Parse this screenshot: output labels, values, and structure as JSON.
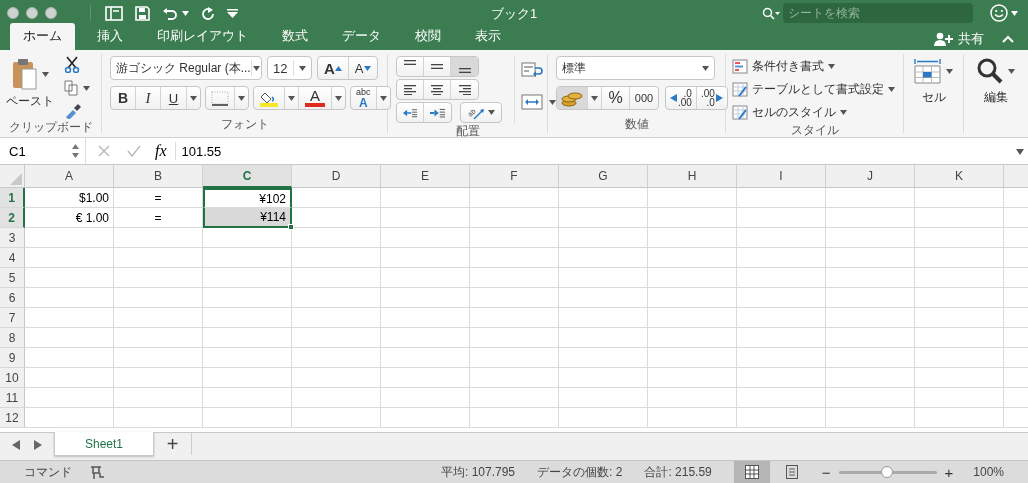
{
  "window": {
    "title": "ブック1"
  },
  "search": {
    "placeholder": "シートを検索"
  },
  "ribbon_tabs": [
    {
      "label": "ホーム",
      "selected": true
    },
    {
      "label": "挿入",
      "selected": false
    },
    {
      "label": "印刷レイアウト",
      "selected": false
    },
    {
      "label": "数式",
      "selected": false
    },
    {
      "label": "データ",
      "selected": false
    },
    {
      "label": "校閲",
      "selected": false
    },
    {
      "label": "表示",
      "selected": false
    }
  ],
  "share": {
    "label": "共有"
  },
  "ribbon": {
    "clipboard": {
      "paste": "ペースト",
      "label": "クリップボード"
    },
    "font": {
      "font_name": "游ゴシック Regular (本...",
      "font_size": "12",
      "grow": "A",
      "shrink": "A",
      "bold": "B",
      "italic": "I",
      "underline": "U",
      "font_color": "A",
      "phonetic_top": "abc",
      "phonetic_bottom": "A",
      "label": "フォント"
    },
    "alignment": {
      "vertical": [
        {
          "selected": false
        },
        {
          "selected": false
        },
        {
          "selected": true
        }
      ],
      "orientation": "ab",
      "label": "配置"
    },
    "number": {
      "format": "標準",
      "percent": "%",
      "comma": "000",
      "decimals": [
        {
          "top": ".0",
          "bottom": ".00"
        },
        {
          "top": ".00",
          "bottom": ".0"
        }
      ],
      "label": "数値"
    },
    "styles": {
      "items": [
        "条件付き書式",
        "テーブルとして書式設定",
        "セルのスタイル"
      ],
      "label": "スタイル"
    },
    "cells": {
      "label": "セル"
    },
    "editing": {
      "label": "編集"
    }
  },
  "formula_bar": {
    "name_box": "C1",
    "fx": "fx",
    "value": "101.55"
  },
  "sheet": {
    "columns": [
      {
        "label": "A",
        "selected": false
      },
      {
        "label": "B",
        "selected": false
      },
      {
        "label": "C",
        "selected": true
      },
      {
        "label": "D",
        "selected": false
      },
      {
        "label": "E",
        "selected": false
      },
      {
        "label": "F",
        "selected": false
      },
      {
        "label": "G",
        "selected": false
      },
      {
        "label": "H",
        "selected": false
      },
      {
        "label": "I",
        "selected": false
      },
      {
        "label": "J",
        "selected": false
      },
      {
        "label": "K",
        "selected": false
      }
    ],
    "rows": [
      {
        "label": "1",
        "selected": true,
        "cells": [
          {
            "text": "$1.00",
            "selected": false,
            "active": false
          },
          {
            "text": "=",
            "selected": false,
            "active": false
          },
          {
            "text": "¥102",
            "selected": true,
            "active": true
          }
        ]
      },
      {
        "label": "2",
        "selected": true,
        "cells": [
          {
            "text": "€ 1.00",
            "selected": false,
            "active": false
          },
          {
            "text": "=",
            "selected": false,
            "active": false
          },
          {
            "text": "¥114",
            "selected": true,
            "active": false
          }
        ]
      },
      {
        "label": "3",
        "selected": false
      },
      {
        "label": "4",
        "selected": false
      },
      {
        "label": "5",
        "selected": false
      },
      {
        "label": "6",
        "selected": false
      },
      {
        "label": "7",
        "selected": false
      },
      {
        "label": "8",
        "selected": false
      },
      {
        "label": "9",
        "selected": false
      },
      {
        "label": "10",
        "selected": false
      },
      {
        "label": "11",
        "selected": false
      },
      {
        "label": "12",
        "selected": false
      }
    ]
  },
  "sheet_tabs": [
    {
      "label": "Sheet1",
      "selected": true
    }
  ],
  "add_sheet": "+",
  "status_bar": {
    "mode": "コマンド",
    "stats": [
      "平均: 107.795",
      "データの個数: 2",
      "合計: 215.59"
    ],
    "views": [
      {
        "selected": true
      },
      {
        "selected": false
      }
    ],
    "zoom_out": "−",
    "zoom_in": "+",
    "zoom": {
      "level": 0.49
    },
    "zoom_text": "100%"
  }
}
